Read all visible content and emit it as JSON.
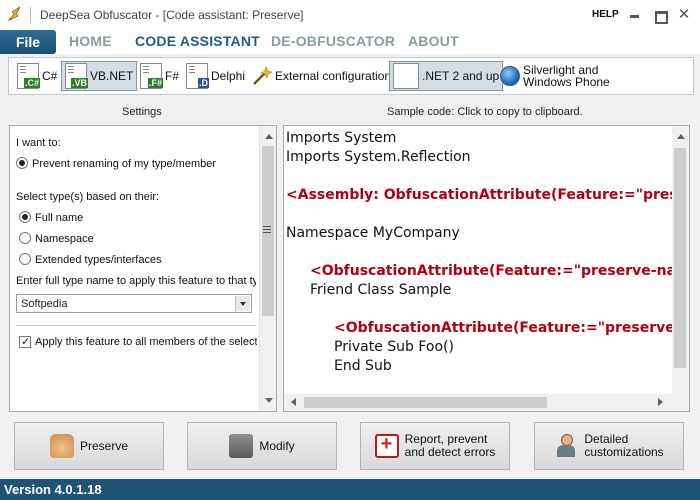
{
  "window": {
    "title": "DeepSea Obfuscator - [Code assistant: Preserve]",
    "help": "HELP",
    "close_glyph": "✕"
  },
  "menu": {
    "file": "File",
    "items": [
      "HOME",
      "CODE ASSISTANT",
      "DE-OBFUSCATOR",
      "ABOUT"
    ],
    "active": "CODE ASSISTANT"
  },
  "toolbar": {
    "languages": [
      {
        "label": "C#",
        "ext": ".C#"
      },
      {
        "label": "VB.NET",
        "ext": ".VB",
        "selected": true
      },
      {
        "label": "F#",
        "ext": ".F#"
      },
      {
        "label": "Delphi",
        "ext": ".D"
      }
    ],
    "external_config": "External configuration",
    "net_version": ".NET 2 and up",
    "silverlight_line1": "Silverlight and",
    "silverlight_line2": "Windows Phone"
  },
  "settings": {
    "heading": "Settings",
    "i_want_to": "I want to:",
    "prevent_option": "Prevent renaming of my type/member",
    "select_types_label": "Select type(s) based on their:",
    "type_options": [
      "Full name",
      "Namespace",
      "Extended types/interfaces"
    ],
    "selected_type_option": "Full name",
    "enter_name_label": "Enter full type name to apply this feature to that ty",
    "type_name_value": "Softpedia",
    "apply_all_label": "Apply this feature to all members of the select",
    "apply_all_checked": true
  },
  "code": {
    "heading": "Sample code: Click to copy to clipboard.",
    "lines": [
      {
        "text": "Imports System",
        "kind": "plain",
        "indent": 0
      },
      {
        "text": "Imports System.Reflection",
        "kind": "plain",
        "indent": 0
      },
      {
        "text": "",
        "kind": "plain",
        "indent": 0
      },
      {
        "text": "<Assembly:  ObfuscationAttribute(Feature:=\"prese",
        "kind": "attr",
        "indent": 0
      },
      {
        "text": "",
        "kind": "plain",
        "indent": 0
      },
      {
        "text": "Namespace MyCompany",
        "kind": "plain",
        "indent": 0
      },
      {
        "text": "",
        "kind": "plain",
        "indent": 0
      },
      {
        "text": "<ObfuscationAttribute(Feature:=\"preserve-nam",
        "kind": "attr",
        "indent": 1
      },
      {
        "text": "Friend Class Sample",
        "kind": "plain",
        "indent": 1
      },
      {
        "text": "",
        "kind": "plain",
        "indent": 0
      },
      {
        "text": "<ObfuscationAttribute(Feature:=\"preserve-",
        "kind": "attr",
        "indent": 2
      },
      {
        "text": "Private Sub Foo()",
        "kind": "plain",
        "indent": 2
      },
      {
        "text": "End Sub",
        "kind": "plain",
        "indent": 2
      }
    ]
  },
  "actions": {
    "preserve": "Preserve",
    "modify": "Modify",
    "report_line1": "Report, prevent",
    "report_line2": "and detect errors",
    "detailed_line1": "Detailed",
    "detailed_line2": "customizations"
  },
  "status": {
    "version": "Version 4.0.1.18"
  },
  "colors": {
    "accent": "#1d5477",
    "code_attribute": "#b00010",
    "menu_inactive": "#8a9aa6"
  }
}
